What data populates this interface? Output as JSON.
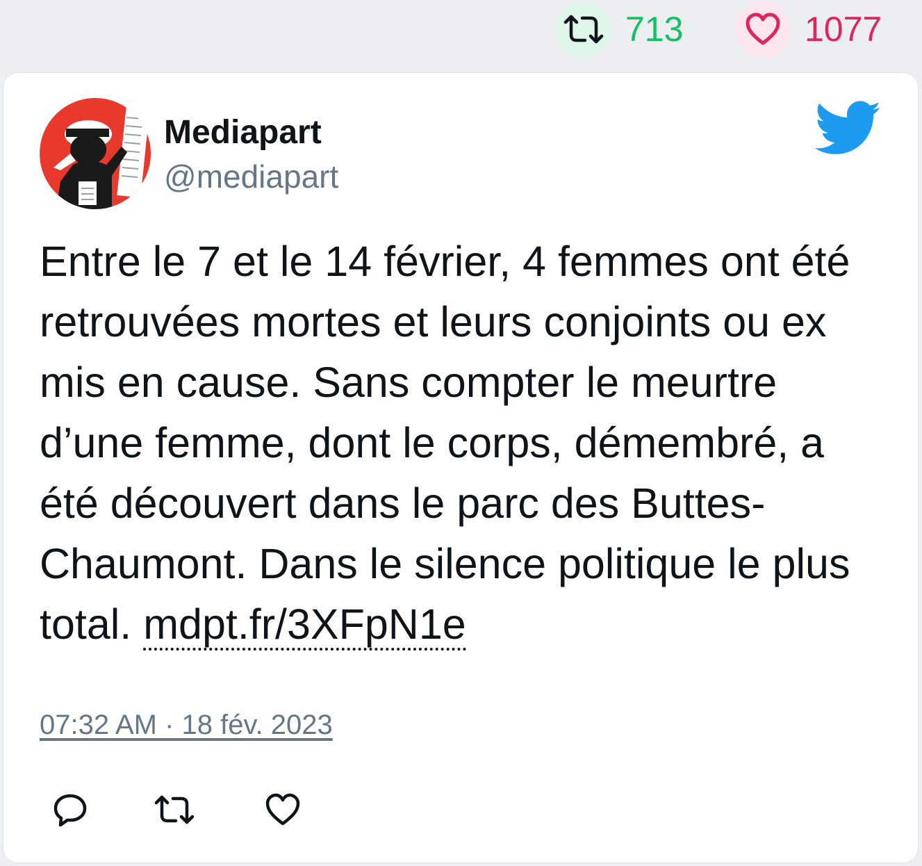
{
  "stats": {
    "retweet_icon": "retweet-icon",
    "retweet_count": "713",
    "retweet_color": "#17bf63",
    "like_icon": "heart-icon",
    "like_count": "1077",
    "like_color": "#e0245e"
  },
  "tweet": {
    "display_name": "Mediapart",
    "handle": "@mediapart",
    "text": "Entre le 7 et le 14 février, 4 femmes ont été retrouvées mortes et leurs conjoints ou ex mis en cause. Sans compter le meurtre d’une femme, dont le corps, démembré, a été découvert dans le parc des Buttes-Chaumont. Dans le silence politique le plus total.",
    "link": "mdpt.fr/3XFpN1e",
    "timestamp": "07:32 AM · 18 fév. 2023",
    "brand_icon": "twitter-bird-icon",
    "brand_color": "#1d9bf0"
  },
  "actions": {
    "reply_icon": "reply-icon",
    "retweet_icon": "retweet-icon",
    "like_icon": "heart-icon"
  }
}
